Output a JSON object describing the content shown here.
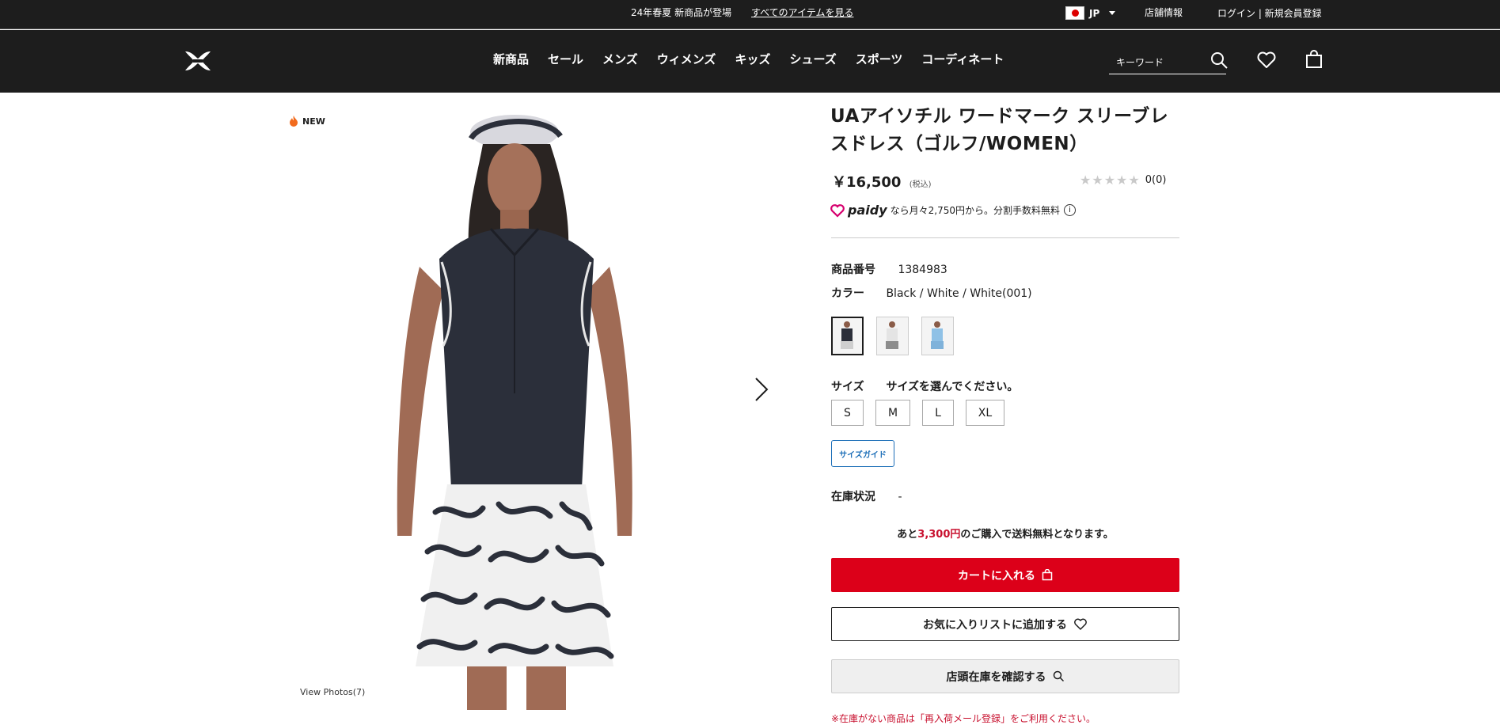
{
  "promo": {
    "message": "24年春夏 新商品が登場",
    "link": "すべてのアイテムを見る",
    "country": "JP",
    "store_info": "店舗情報",
    "login": "ログイン | 新規会員登録"
  },
  "header": {
    "nav": [
      "新商品",
      "セール",
      "メンズ",
      "ウィメンズ",
      "キッズ",
      "シューズ",
      "スポーツ",
      "コーディネート"
    ],
    "search_placeholder": "キーワード"
  },
  "gallery": {
    "badge": "NEW",
    "view_photos": "View Photos(7)"
  },
  "product": {
    "title": "UAアイソチル ワードマーク スリーブレスドレス（ゴルフ/WOMEN）",
    "price": "￥16,500",
    "tax_note": "(税込)",
    "rating_count": "0",
    "review_count": "(0)",
    "paidy_brand": "paidy",
    "paidy_text": "なら月々2,750円から。分割手数料無料",
    "item_number_label": "商品番号",
    "item_number": "1384983",
    "color_label": "カラー",
    "color_value": "Black / White / White(001)",
    "swatch_colors": [
      "#2b2f3a",
      "#ececec",
      "#8fc1e6"
    ],
    "size_label": "サイズ",
    "size_prompt": "サイズを選んでください。",
    "sizes": [
      "S",
      "M",
      "L",
      "XL"
    ],
    "size_guide": "サイズガイド",
    "stock_label": "在庫状況",
    "stock_value": "-",
    "shipping_prefix": "あと",
    "shipping_amount": "3,300円",
    "shipping_suffix": "のご購入で送料無料となります。",
    "cart_button": "カートに入れる",
    "favorite_button": "お気に入りリストに追加する",
    "store_button": "店頭在庫を確認する",
    "notice": "※在庫がない商品は「再入荷メール登録」をご利用ください。"
  },
  "colors": {
    "header_bg": "#1d1d1d",
    "accent_red": "#dc0019",
    "link_blue": "#1d6fb8"
  }
}
